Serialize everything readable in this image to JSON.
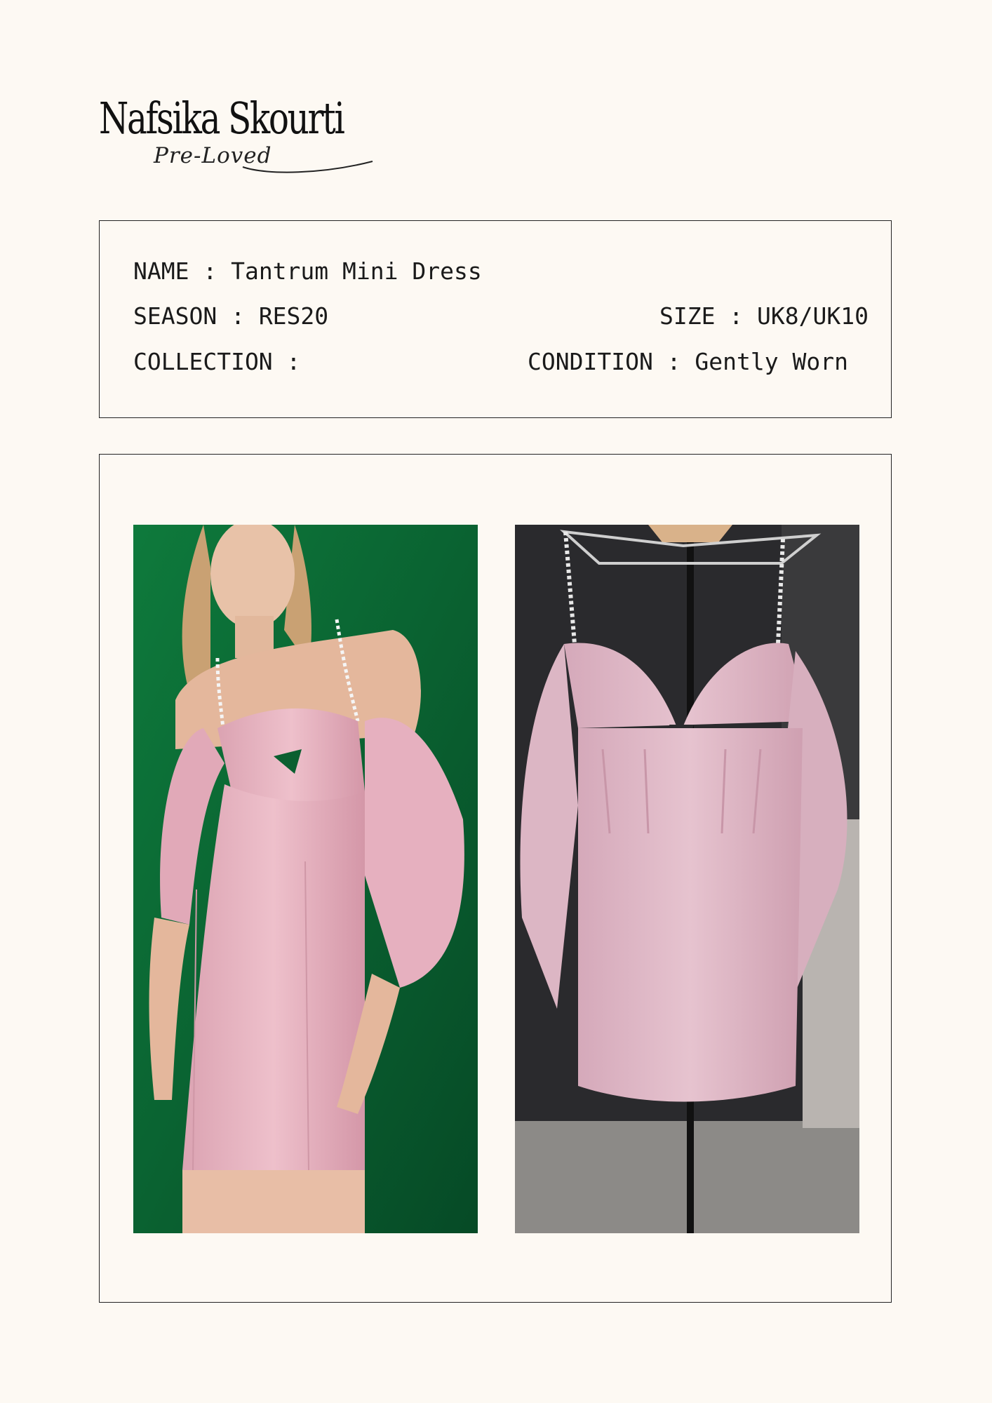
{
  "brand": {
    "name": "Nafsika Skourti",
    "tagline": "Pre-Loved"
  },
  "product": {
    "name_label": "NAME : ",
    "name": "Tantrum Mini Dress",
    "season_label": "SEASON : ",
    "season": "RES20",
    "size_label": "SIZE : ",
    "size": "UK8/UK10",
    "collection_label": "COLLECTION : ",
    "collection": "",
    "condition_label": "CONDITION : ",
    "condition": "Gently Worn"
  },
  "colors": {
    "background": "#fdf9f3",
    "dress_pink": "#e6b3bf",
    "studio_green": "#0c6a35",
    "hanger_bg": "#2a2a2d"
  },
  "photos": [
    {
      "name": "model-wearing-dress-photo"
    },
    {
      "name": "dress-on-hanger-photo"
    }
  ]
}
